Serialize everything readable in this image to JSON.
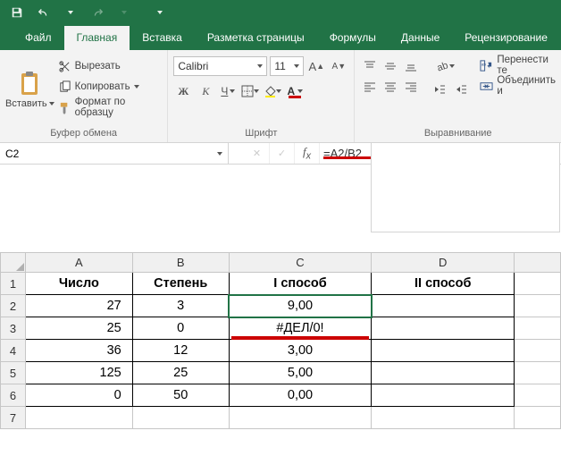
{
  "qat": {
    "save": "save",
    "undo": "undo",
    "redo": "redo"
  },
  "tabs": {
    "file": "Файл",
    "home": "Главная",
    "insert": "Вставка",
    "layout": "Разметка страницы",
    "formulas": "Формулы",
    "data": "Данные",
    "review": "Рецензирование"
  },
  "clipboard": {
    "paste": "Вставить",
    "cut": "Вырезать",
    "copy": "Копировать",
    "format_painter": "Формат по образцу",
    "group_label": "Буфер обмена"
  },
  "font": {
    "name": "Calibri",
    "size": "11",
    "grow_tip": "A",
    "shrink_tip": "A",
    "bold": "Ж",
    "italic": "К",
    "underline": "Ч",
    "group_label": "Шрифт"
  },
  "alignment": {
    "wrap": "Перенести те",
    "merge": "Объединить и",
    "group_label": "Выравнивание"
  },
  "name_box": "C2",
  "formula": "=A2/B2",
  "headers": {
    "A": "A",
    "B": "B",
    "C": "C",
    "D": "D"
  },
  "row_headers": [
    "1",
    "2",
    "3",
    "4",
    "5",
    "6",
    "7"
  ],
  "table": {
    "h_a": "Число",
    "h_b": "Степень",
    "h_c": "I способ",
    "h_d": "II способ",
    "rows": [
      {
        "a": "27",
        "b": "3",
        "c": "9,00",
        "d": ""
      },
      {
        "a": "25",
        "b": "0",
        "c": "#ДЕЛ/0!",
        "d": ""
      },
      {
        "a": "36",
        "b": "12",
        "c": "3,00",
        "d": ""
      },
      {
        "a": "125",
        "b": "25",
        "c": "5,00",
        "d": ""
      },
      {
        "a": "0",
        "b": "50",
        "c": "0,00",
        "d": ""
      }
    ]
  },
  "colors": {
    "brand": "#217346",
    "highlight": "#c00"
  }
}
